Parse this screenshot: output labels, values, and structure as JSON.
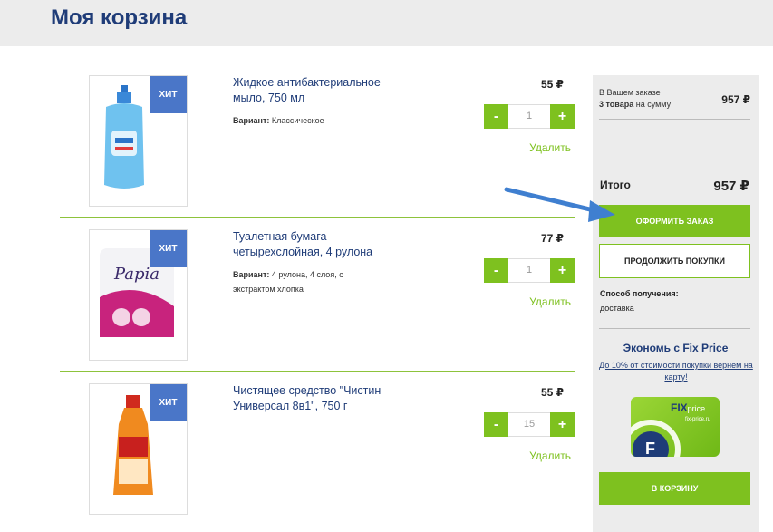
{
  "page": {
    "title": "Моя корзина"
  },
  "items": [
    {
      "badge": "ХИТ",
      "title": "Жидкое антибактериальное мыло, 750 мл",
      "variant_label": "Вариант:",
      "variant_value": "Классическое",
      "price": "55 ₽",
      "quantity": "1",
      "minus": "-",
      "plus": "+",
      "remove": "Удалить"
    },
    {
      "badge": "ХИТ",
      "title": "Туалетная бумага четырехслойная, 4 рулона",
      "variant_label": "Вариант:",
      "variant_value": "4 рулона, 4 слоя, с экстрактом хлопка",
      "price": "77 ₽",
      "quantity": "1",
      "minus": "-",
      "plus": "+",
      "remove": "Удалить"
    },
    {
      "badge": "ХИТ",
      "title": "Чистящее средство \"Чистин Универсал 8в1\", 750 г",
      "variant_label": "",
      "variant_value": "",
      "price": "55 ₽",
      "quantity": "15",
      "minus": "-",
      "plus": "+",
      "remove": "Удалить"
    }
  ],
  "summary": {
    "in_order": "В Вашем заказе",
    "count": "3 товара",
    "for_sum": "на сумму",
    "amount": "957 ₽",
    "total_label": "Итого",
    "total_value": "957 ₽",
    "checkout_label": "ОФОРМИТЬ ЗАКАЗ",
    "continue_label": "ПРОДОЛЖИТЬ ПОКУПКИ",
    "delivery_label": "Способ получения:",
    "delivery_value": "доставка",
    "save_title": "Экономь с Fix Price",
    "save_link": "До 10% от стоимости покупки вернем на карту!",
    "card_brand": "FIX price",
    "card_site": "fix-price.ru",
    "add_to_cart_label": "В КОРЗИНУ"
  },
  "colors": {
    "accent_green": "#7ec11f",
    "title_blue": "#1f3c78",
    "badge_blue": "#4a76c8",
    "arrow_blue": "#3f7fd0"
  },
  "icons": [
    "arrow-annotation-icon"
  ]
}
